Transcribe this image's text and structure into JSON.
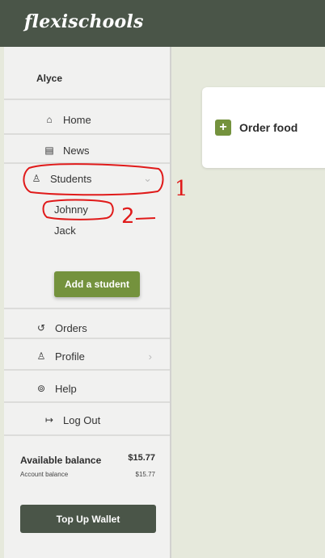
{
  "header": {
    "logo_text": "flexischools"
  },
  "sidebar": {
    "user_name": "Alyce",
    "nav": {
      "home": "Home",
      "news": "News",
      "students": "Students",
      "orders": "Orders",
      "profile": "Profile",
      "help": "Help",
      "logout": "Log Out"
    },
    "students_list": [
      "Johnny",
      "Jack"
    ],
    "add_student_label": "Add a student",
    "balance": {
      "available_label": "Available balance",
      "available_value": "$15.77",
      "account_label": "Account balance",
      "account_value": "$15.77"
    },
    "topup_label": "Top Up Wallet"
  },
  "main": {
    "order_food_label": "Order food"
  },
  "annotations": {
    "mark_1": "1",
    "mark_2": "2"
  },
  "colors": {
    "header": "#4a5548",
    "accent": "#74923d",
    "background": "#e6e9dc",
    "annotation": "#e01a1a"
  }
}
